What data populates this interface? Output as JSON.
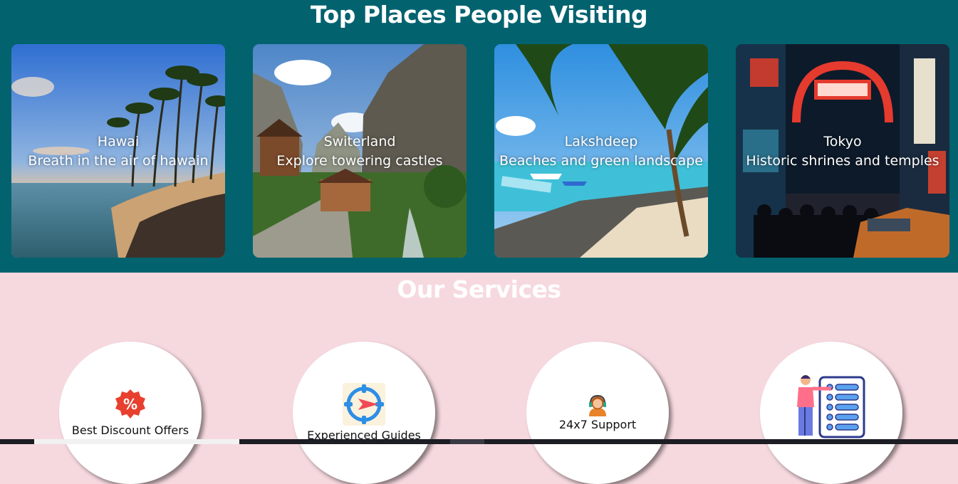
{
  "places": {
    "title": "Top Places People Visiting",
    "cards": [
      {
        "name": "Hawai",
        "desc": "Breath in the air of hawain"
      },
      {
        "name": "Switerland",
        "desc": "Explore towering castles"
      },
      {
        "name": "Lakshdeep",
        "desc": "Beaches and green landscape"
      },
      {
        "name": "Tokyo",
        "desc": "Historic shrines and temples"
      }
    ]
  },
  "services": {
    "title": "Our Services",
    "items": [
      {
        "label": "Best Discount Offers",
        "icon": "discount-badge-icon"
      },
      {
        "label": "Experienced Guides",
        "icon": "compass-target-icon"
      },
      {
        "label": "24x7 Support",
        "icon": "support-agent-icon"
      },
      {
        "label": "",
        "icon": "presenter-checklist-icon"
      }
    ]
  },
  "colors": {
    "places_bg": "#02636f",
    "services_bg": "#f6d9df",
    "heading": "#ffffff"
  }
}
